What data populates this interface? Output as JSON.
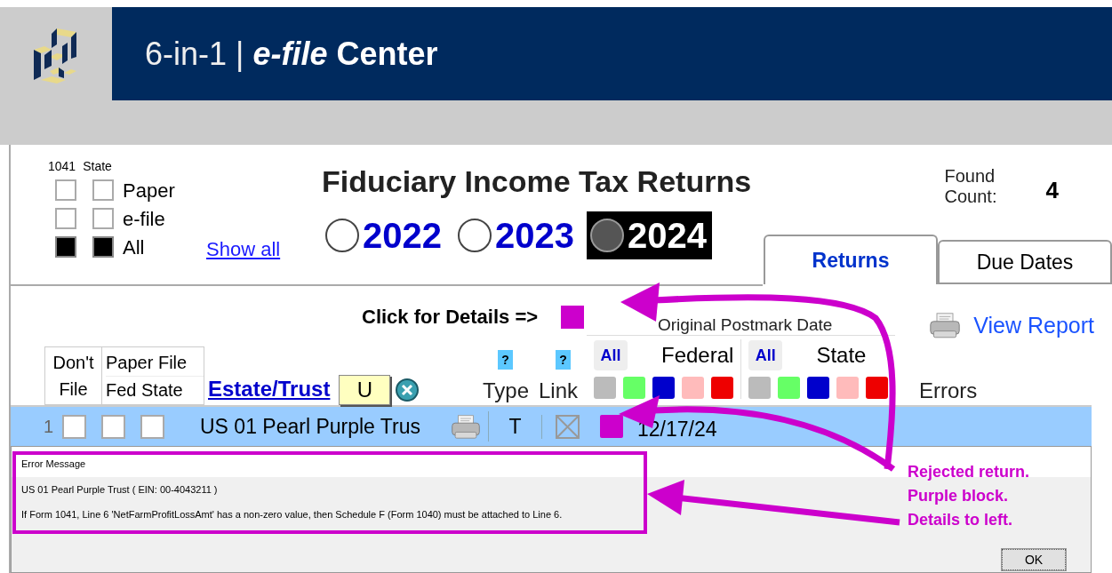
{
  "header": {
    "product": "6-in-1",
    "separator": "|",
    "title": "*e-file* Center"
  },
  "filters": {
    "columns": [
      "1041",
      "State"
    ],
    "rows": [
      {
        "label": "Paper",
        "checks": [
          false,
          false
        ]
      },
      {
        "label": "e-file",
        "checks": [
          false,
          false
        ]
      },
      {
        "label": "All",
        "checks": [
          true,
          true
        ]
      }
    ],
    "link": "Show all"
  },
  "title": "Fiduciary Income Tax Returns",
  "years": [
    {
      "label": "2022",
      "selected": false
    },
    {
      "label": "2023",
      "selected": false
    },
    {
      "label": "2024",
      "selected": true
    }
  ],
  "found": {
    "label": "Found Count:",
    "value": "4"
  },
  "tabs": [
    {
      "label": "Returns",
      "selected": true
    },
    {
      "label": "Due Dates",
      "selected": false
    }
  ],
  "details": {
    "prompt": "Click for Details =>",
    "color": "#cc00cc"
  },
  "view_report": "View Report",
  "postmark": {
    "title": "Original Postmark Date",
    "groups": [
      {
        "label": "Federal",
        "all": "All",
        "swatches": [
          {
            "color": "#bbbbbb"
          },
          {
            "color": "#66ff66"
          },
          {
            "color": "#0000cc"
          },
          {
            "color": "#ffbbbb"
          },
          {
            "color": "#ee0000"
          }
        ]
      },
      {
        "label": "State",
        "all": "All",
        "swatches": [
          {
            "color": "#bbbbbb"
          },
          {
            "color": "#66ff66"
          },
          {
            "color": "#0000cc"
          },
          {
            "color": "#ffbbbb"
          },
          {
            "color": "#ee0000"
          }
        ]
      }
    ]
  },
  "columns": {
    "dont_file": "Don't File",
    "paper_file": "Paper File",
    "fed_state": "Fed State",
    "estate_trust": "Estate/Trust",
    "filter_value": "U",
    "type_help": "?",
    "link_help": "?",
    "type": "Type",
    "link": "Link",
    "errors": "Errors"
  },
  "rows": [
    {
      "number": "1",
      "checks": [
        false,
        false,
        false
      ],
      "name": "US 01 Pearl Purple Trus",
      "type": "T",
      "linked": true,
      "color": "#cc00cc",
      "date": "12/17/24",
      "selected": true
    }
  ],
  "error_panel": {
    "header": "Error Message",
    "lines": [
      "US 01 Pearl Purple Trust ( EIN:  00-4043211 )",
      "If Form 1041, Line 6 'NetFarmProfitLossAmt' has a non-zero value, then Schedule F (Form 1040) must be attached to Line 6."
    ],
    "ok": "OK"
  },
  "annotation": {
    "lines": [
      "Rejected return.",
      "Purple block.",
      "Details to left."
    ]
  }
}
